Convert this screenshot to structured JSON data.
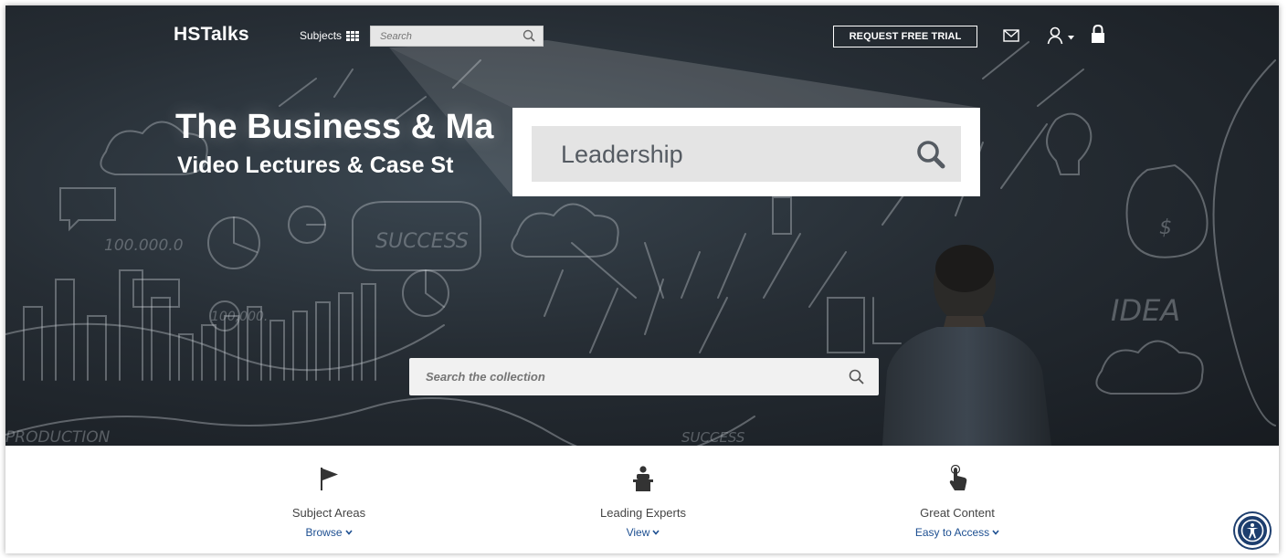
{
  "header": {
    "logo": "HSTalks",
    "subjects_label": "Subjects",
    "search_placeholder": "Search",
    "trial_button": "REQUEST FREE TRIAL"
  },
  "hero": {
    "title": "The Business & Ma",
    "subtitle": "Video Lectures & Case St",
    "zoom_search_value": "Leadership",
    "main_search_placeholder": "Search the collection",
    "chalk_labels": [
      "100.000.0",
      "SUCCESS",
      "100,000.",
      "PRODUCTION",
      "SUCCESS",
      "IDEA",
      "$"
    ]
  },
  "features": [
    {
      "title": "Subject Areas",
      "link": "Browse",
      "icon": "flag-icon"
    },
    {
      "title": "Leading Experts",
      "link": "View",
      "icon": "lecturer-podium-icon"
    },
    {
      "title": "Great Content",
      "link": "Easy to Access",
      "icon": "pointing-hand-icon"
    }
  ],
  "colors": {
    "hero_bg": "#262d34",
    "link": "#1d4f91",
    "accessibility": "#1d3e6e"
  },
  "icons": {
    "grid": "grid-icon",
    "search": "search-icon",
    "mail": "mail-icon",
    "user": "user-icon",
    "lock": "lock-icon",
    "accessibility": "accessibility-icon"
  }
}
